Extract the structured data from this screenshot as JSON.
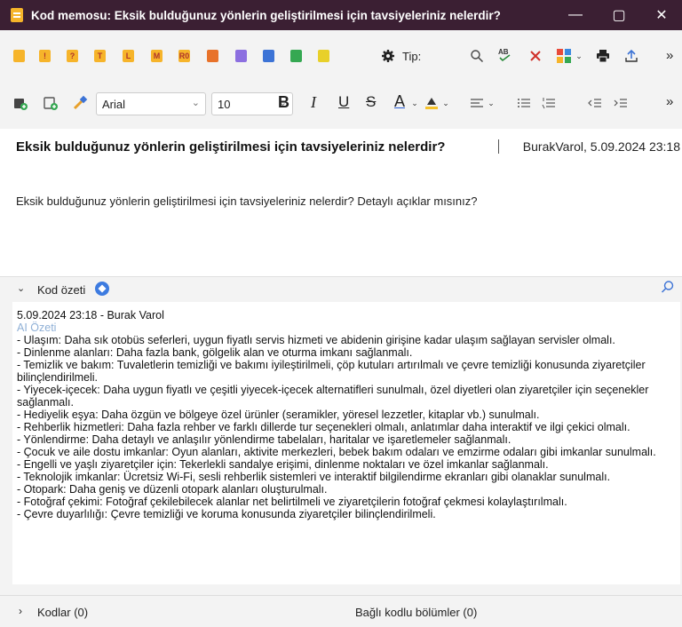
{
  "window": {
    "title": "Kod memosu: Eksik bulduğunuz yönlerin geliştirilmesi için tavsiyeleriniz nelerdir? Detay...",
    "minimize": "—",
    "maximize": "▢",
    "close": "✕"
  },
  "toolbar1": {
    "marker_labels": [
      "",
      "!",
      "?",
      "T",
      "L",
      "M",
      "R0",
      "",
      "",
      "",
      "",
      ""
    ],
    "marker_colors": [
      "#f6b42a",
      "#f6b42a",
      "#f6b42a",
      "#f6b42a",
      "#f6b42a",
      "#f6b42a",
      "#f6b42a",
      "#e8722a",
      "#8c6fe0",
      "#3c73d6",
      "#35a852",
      "#e8d02a"
    ],
    "type_label": "Tip:",
    "more": "»"
  },
  "toolbar2": {
    "font": "Arial",
    "size": "10",
    "bold": "B",
    "italic": "I",
    "underline": "U",
    "strike": "S",
    "fontcolor": "A",
    "more": "»"
  },
  "header": {
    "question": "Eksik bulduğunuz yönlerin geliştirilmesi için tavsiyeleriniz nelerdir?",
    "author_date": "BurakVarol, 5.09.2024 23:18"
  },
  "memo": {
    "text": "Eksik bulduğunuz yönlerin geliştirilmesi için tavsiyeleriniz nelerdir? Detaylı açıklar mısınız?"
  },
  "summary": {
    "label": "Kod özeti",
    "stamp": "5.09.2024 23:18 - Burak Varol",
    "ai_label": "AI Özeti",
    "lines": [
      "- Ulaşım: Daha sık otobüs seferleri, uygun fiyatlı servis hizmeti ve abidenin girişine kadar ulaşım sağlayan servisler olmalı.",
      "- Dinlenme alanları: Daha fazla bank, gölgelik alan ve oturma imkanı sağlanmalı.",
      "- Temizlik ve bakım: Tuvaletlerin temizliği ve bakımı iyileştirilmeli, çöp kutuları artırılmalı ve çevre temizliği konusunda ziyaretçiler bilinçlendirilmeli.",
      "- Yiyecek-içecek: Daha uygun fiyatlı ve çeşitli yiyecek-içecek alternatifleri sunulmalı, özel diyetleri olan ziyaretçiler için seçenekler sağlanmalı.",
      "- Hediyelik eşya: Daha özgün ve bölgeye özel ürünler (seramikler, yöresel lezzetler, kitaplar vb.) sunulmalı.",
      "- Rehberlik hizmetleri: Daha fazla rehber ve farklı dillerde tur seçenekleri olmalı, anlatımlar daha interaktif ve ilgi çekici olmalı.",
      "- Yönlendirme: Daha detaylı ve anlaşılır yönlendirme tabelaları, haritalar ve işaretlemeler sağlanmalı.",
      "- Çocuk ve aile dostu imkanlar: Oyun alanları, aktivite merkezleri, bebek bakım odaları ve emzirme odaları gibi imkanlar sunulmalı.",
      "- Engelli ve yaşlı ziyaretçiler için: Tekerlekli sandalye erişimi, dinlenme noktaları ve özel imkanlar sağlanmalı.",
      "- Teknolojik imkanlar: Ücretsiz Wi-Fi, sesli rehberlik sistemleri ve interaktif bilgilendirme ekranları gibi olanaklar sunulmalı.",
      "- Otopark: Daha geniş ve düzenli otopark alanları oluşturulmalı.",
      "- Fotoğraf çekimi: Fotoğraf çekilebilecek alanlar net belirtilmeli ve ziyaretçilerin fotoğraf çekmesi kolaylaştırılmalı.",
      "- Çevre duyarlılığı: Çevre temizliği ve koruma konusunda ziyaretçiler bilinçlendirilmeli."
    ]
  },
  "bottom": {
    "codes": "Kodlar (0)",
    "linked": "Bağlı kodlu bölümler (0)"
  }
}
